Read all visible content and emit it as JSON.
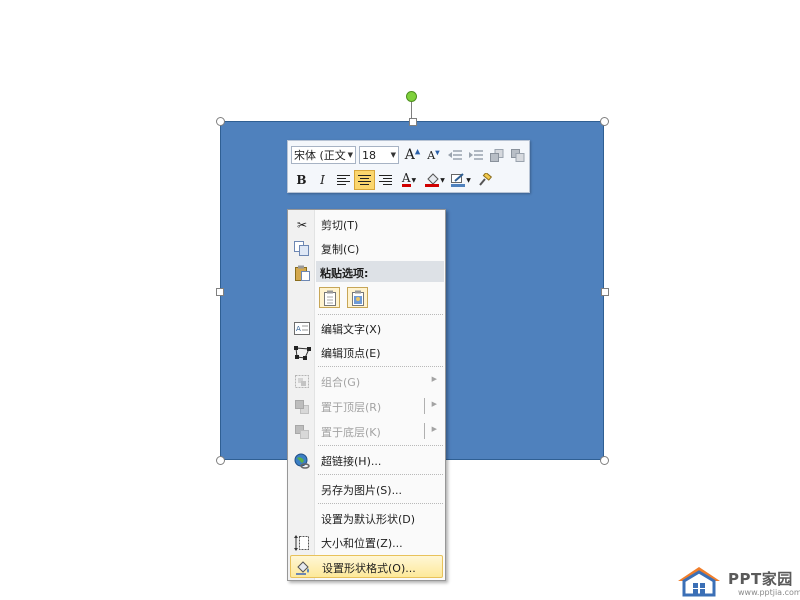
{
  "colors": {
    "shape_fill": "#4f81bd",
    "rotate_handle": "#7fd13b",
    "highlight": "#fde99a",
    "font_color_red": "#d00000"
  },
  "minibar": {
    "font_name": "宋体 (正文",
    "font_size": "18",
    "buttons_row1": [
      "grow-font-icon",
      "shrink-font-icon",
      "decrease-indent-icon",
      "increase-indent-icon",
      "bring-forward-icon",
      "send-backward-icon"
    ],
    "bold": "B",
    "italic": "I",
    "font_color_glyph": "A"
  },
  "menu": {
    "cut": "剪切(T)",
    "copy": "复制(C)",
    "paste_options": "粘贴选项:",
    "edit_text": "编辑文字(X)",
    "edit_points": "编辑顶点(E)",
    "group": "组合(G)",
    "bring_to_front": "置于顶层(R)",
    "send_to_back": "置于底层(K)",
    "hyperlink": "超链接(H)...",
    "save_as_picture": "另存为图片(S)...",
    "set_default_shape": "设置为默认形状(D)",
    "size_position": "大小和位置(Z)...",
    "format_shape": "设置形状格式(O)..."
  },
  "logo": {
    "name": "PPT家园",
    "url": "www.pptjia.com"
  }
}
